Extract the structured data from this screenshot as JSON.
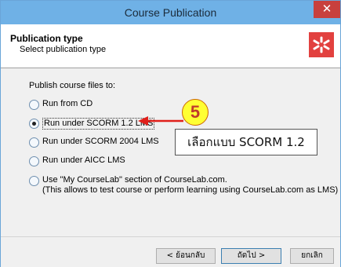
{
  "window": {
    "title": "Course Publication",
    "close_glyph": "✕"
  },
  "header": {
    "title": "Publication type",
    "subtitle": "Select publication type",
    "logo_icon": "courselab-logo-icon",
    "logo_color": "#e2413f"
  },
  "content": {
    "prompt": "Publish course files to:",
    "options": [
      {
        "label": "Run from CD",
        "checked": false
      },
      {
        "label": "Run under SCORM 1.2 LMS",
        "checked": true
      },
      {
        "label": "Run under SCORM 2004 LMS",
        "checked": false
      },
      {
        "label": "Run under AICC LMS",
        "checked": false
      },
      {
        "label": "Use \"My CourseLab\" section of CourseLab.com.",
        "line2": "(This allows to test course or perform learning using CourseLab.com as LMS)",
        "checked": false
      }
    ]
  },
  "annotation": {
    "step_number": "5",
    "callout_text": "เลือกแบบ SCORM 1.2",
    "arrow_color": "#e0201b",
    "badge_color": "#ffff33"
  },
  "footer": {
    "back_label": "< ย้อนกลับ",
    "next_label": "ถัดไป >",
    "cancel_label": "ยกเลิก"
  }
}
